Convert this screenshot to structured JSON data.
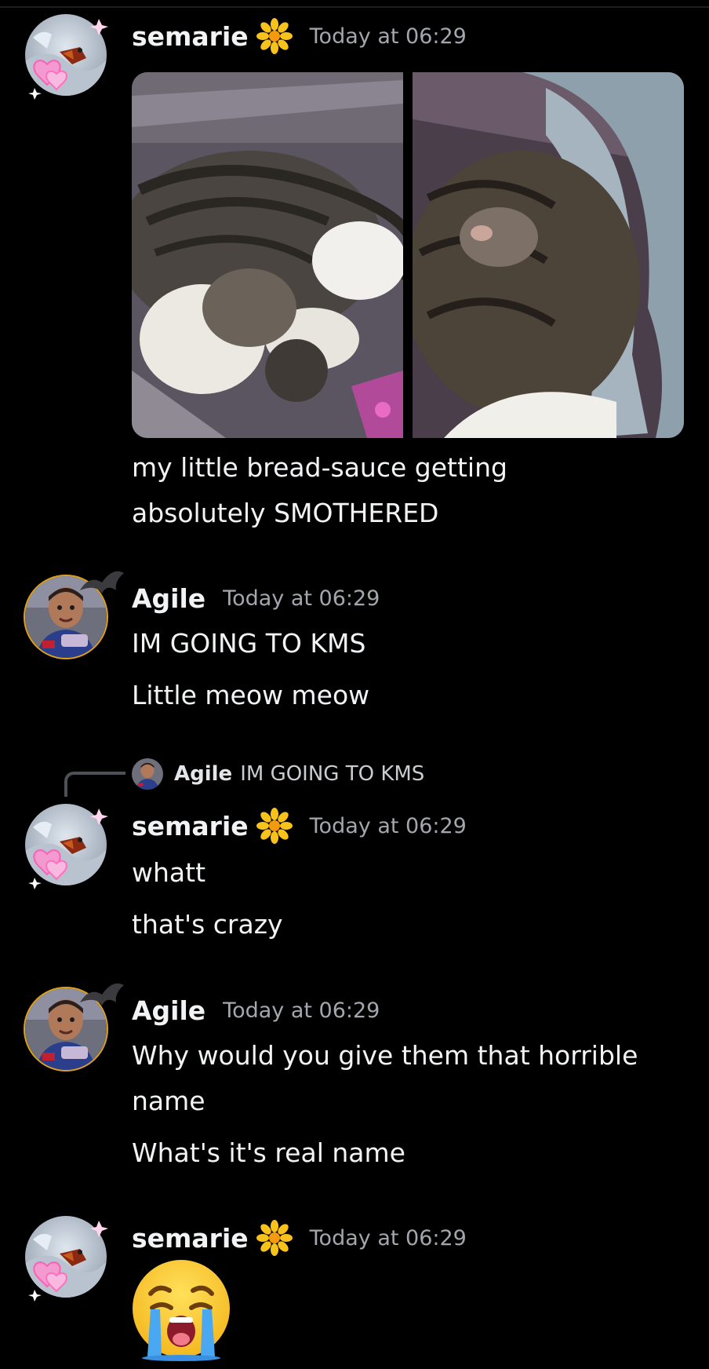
{
  "messages": [
    {
      "author": "semarie",
      "timestamp": "Today at 06:29",
      "author_badge_icon": "flower-badge-icon",
      "attachments": [
        "cat-photo-1",
        "cat-photo-2"
      ],
      "lines": [
        "my little bread-sauce getting",
        "absolutely SMOTHERED"
      ]
    },
    {
      "author": "Agile",
      "timestamp": "Today at 06:29",
      "lines": [
        "IM GOING TO KMS",
        "Little meow meow"
      ]
    },
    {
      "reply_to": {
        "author": "Agile",
        "text": "IM GOING TO KMS"
      },
      "author": "semarie",
      "timestamp": "Today at 06:29",
      "author_badge_icon": "flower-badge-icon",
      "lines": [
        "whatt",
        "that's crazy"
      ]
    },
    {
      "author": "Agile",
      "timestamp": "Today at 06:29",
      "lines": [
        "Why would you give them that horrible",
        "name",
        "What's it's real name"
      ]
    },
    {
      "author": "semarie",
      "timestamp": "Today at 06:29",
      "author_badge_icon": "flower-badge-icon",
      "emoji": "crying-face-icon"
    }
  ],
  "colors": {
    "background": "#000000",
    "text": "#f2f3f5",
    "timestamp": "#a3a6ad",
    "reply_line": "#4e5058"
  }
}
